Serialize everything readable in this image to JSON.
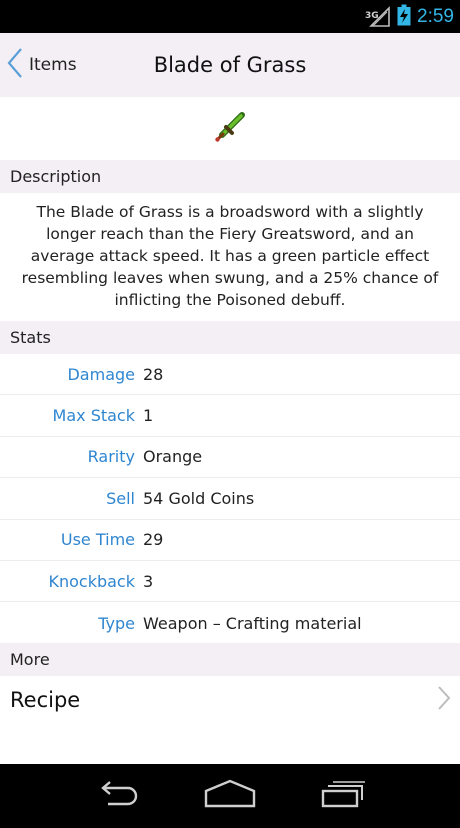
{
  "status_bar": {
    "network": "3G",
    "time": "2:59",
    "icons": [
      "signal-icon",
      "battery-charging-icon"
    ]
  },
  "action_bar": {
    "back_label": "Items",
    "title": "Blade of Grass",
    "back_icon": "chevron-left-icon"
  },
  "item": {
    "icon": "blade-of-grass-sword-icon"
  },
  "description": {
    "header": "Description",
    "text": "The Blade of Grass is a broadsword with a slightly longer reach than the Fiery Greatsword, and an average attack speed. It has a green particle effect resembling leaves when swung, and a 25% chance of inflicting the Poisoned debuff."
  },
  "stats": {
    "header": "Stats",
    "rows": [
      {
        "label": "Damage",
        "value": "28"
      },
      {
        "label": "Max Stack",
        "value": "1"
      },
      {
        "label": "Rarity",
        "value": "Orange"
      },
      {
        "label": "Sell",
        "value": "54 Gold Coins"
      },
      {
        "label": "Use Time",
        "value": "29"
      },
      {
        "label": "Knockback",
        "value": "3"
      },
      {
        "label": "Type",
        "value": "Weapon – Crafting material"
      }
    ]
  },
  "more": {
    "header": "More",
    "recipe_label": "Recipe",
    "recipe_icon": "chevron-right-icon"
  },
  "nav_bar": {
    "buttons": [
      "back-icon",
      "home-icon",
      "recent-apps-icon"
    ]
  },
  "colors": {
    "accent": "#33b5e5",
    "stat_label": "#2f86d0",
    "header_bg": "#f3eff4"
  }
}
